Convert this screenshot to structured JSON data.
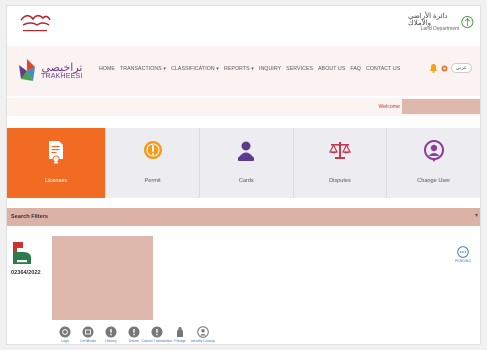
{
  "header": {
    "gov_name_ar": "دائرة الأراضي والأملاك",
    "gov_name_en": "Land Department"
  },
  "brand": {
    "name_ar": "تراخيصي",
    "name_en": "TRAKHEESI"
  },
  "menu": {
    "items": [
      "HOME",
      "TRANSACTIONS ▾",
      "CLASSIFICATION ▾",
      "REPORTS ▾",
      "INQUIRY",
      "SERVICES",
      "ABOUT US",
      "FAQ",
      "CONTACT US"
    ],
    "language": "عربي"
  },
  "welcome": {
    "label": "Welcome"
  },
  "tiles": [
    {
      "label": "Licenses",
      "icon": "license-icon",
      "active": true
    },
    {
      "label": "Permit",
      "icon": "permit-icon",
      "active": false
    },
    {
      "label": "Cards",
      "icon": "card-person-icon",
      "active": false
    },
    {
      "label": "Disputes",
      "icon": "scales-icon",
      "active": false
    },
    {
      "label": "Change User",
      "icon": "change-user-icon",
      "active": false
    }
  ],
  "filters": {
    "title": "Search Filters"
  },
  "result": {
    "reference": "02364/2022",
    "more_label": "PENDING"
  },
  "actions": [
    {
      "label": "Logs"
    },
    {
      "label": "Certificate"
    },
    {
      "label": "History"
    },
    {
      "label": "Delete"
    },
    {
      "label": "Cancel Transaction"
    },
    {
      "label": "Pledge"
    },
    {
      "label": "Identity Lookup"
    }
  ],
  "colors": {
    "accent": "#f26b23",
    "brand_purple": "#6a3b87",
    "filter_bar": "#dcb1a6",
    "redacted": "#deb8ad"
  }
}
